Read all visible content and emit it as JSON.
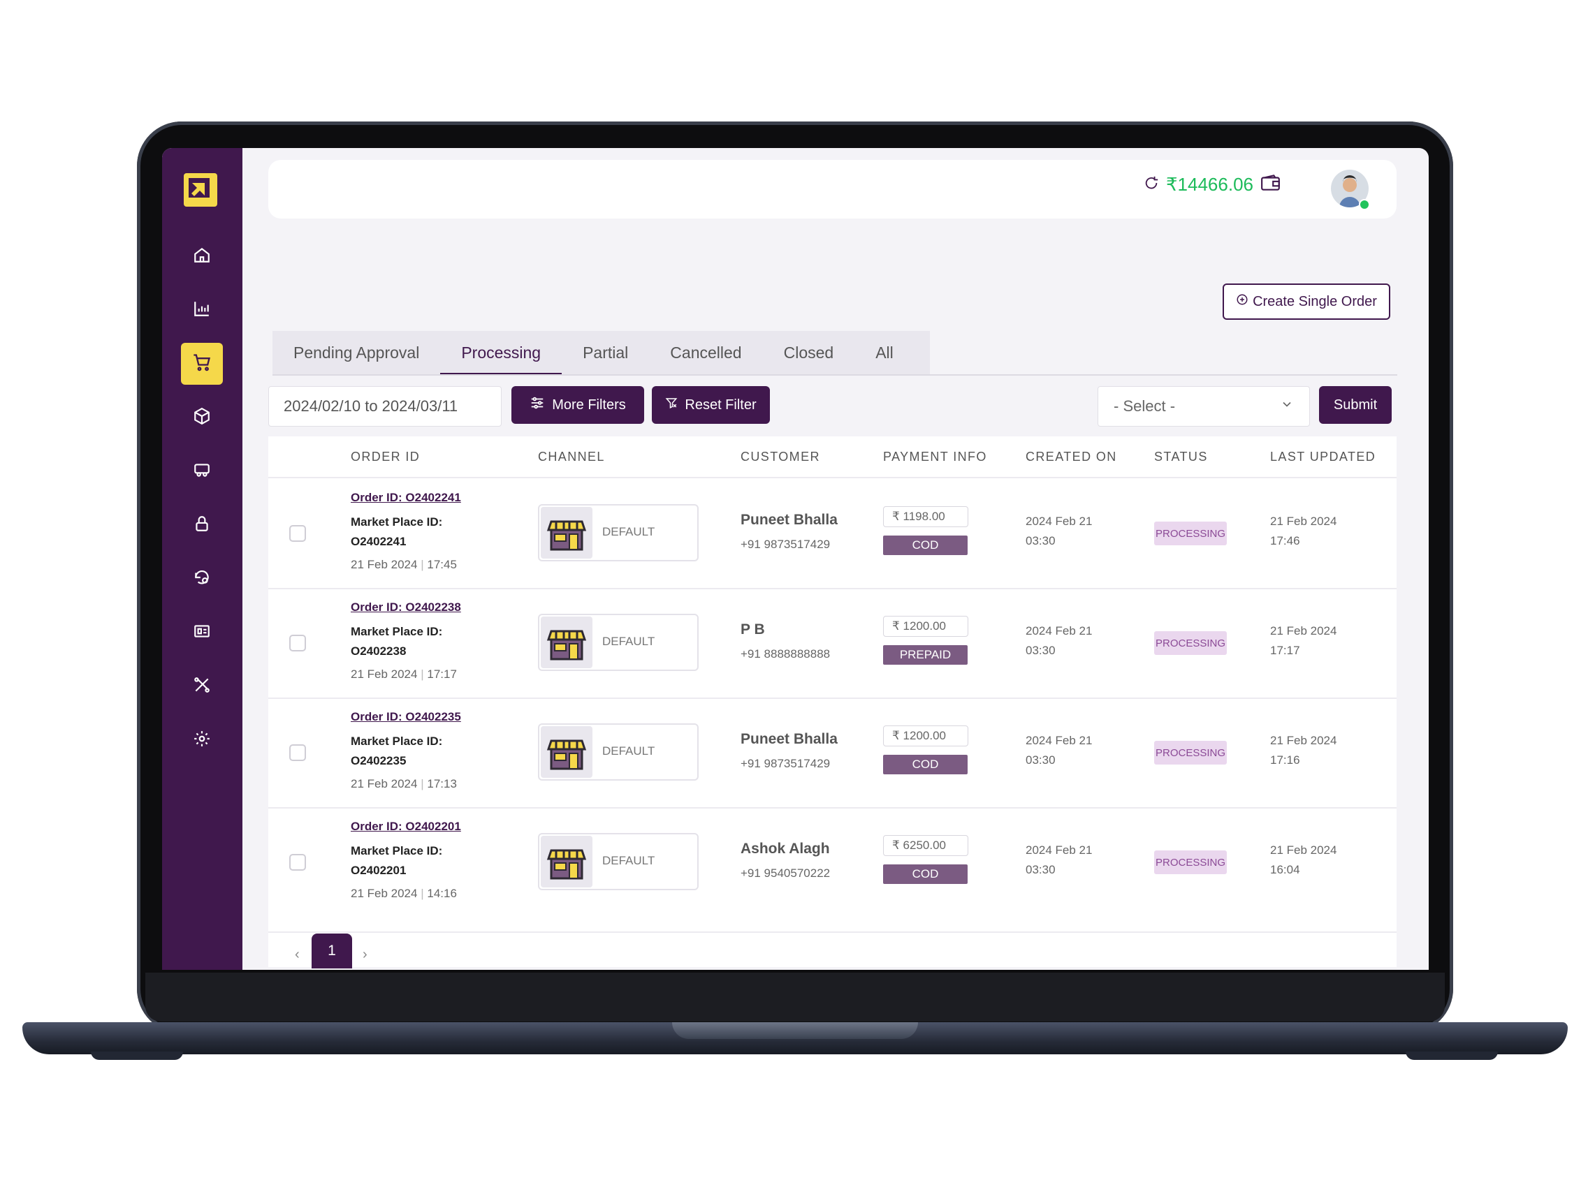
{
  "header": {
    "balance": "₹14466.06"
  },
  "actions": {
    "create_single_order": "Create Single Order"
  },
  "tabs": [
    {
      "label": "Pending Approval"
    },
    {
      "label": "Processing"
    },
    {
      "label": "Partial"
    },
    {
      "label": "Cancelled"
    },
    {
      "label": "Closed"
    },
    {
      "label": "All"
    }
  ],
  "active_tab": "Processing",
  "filters": {
    "date_range": "2024/02/10 to 2024/03/11",
    "more_filters": "More Filters",
    "reset_filter": "Reset Filter",
    "select_value": "- Select -",
    "submit": "Submit"
  },
  "table": {
    "columns": [
      "ORDER ID",
      "CHANNEL",
      "CUSTOMER",
      "PAYMENT INFO",
      "CREATED ON",
      "STATUS",
      "LAST UPDATED"
    ],
    "rows": [
      {
        "order_id": "Order ID: O2402241",
        "marketplace_label": "Market Place ID:",
        "marketplace_id": "O2402241",
        "order_date": "21 Feb 2024",
        "order_time": "17:45",
        "channel": "DEFAULT",
        "customer": "Puneet Bhalla",
        "phone": "+91 9873517429",
        "amount": "₹ 1198.00",
        "payment_mode": "COD",
        "created_date": "2024 Feb 21",
        "created_time": "03:30",
        "status": "PROCESSING",
        "updated_date": "21 Feb 2024",
        "updated_time": "17:46"
      },
      {
        "order_id": "Order ID: O2402238",
        "marketplace_label": "Market Place ID:",
        "marketplace_id": "O2402238",
        "order_date": "21 Feb 2024",
        "order_time": "17:17",
        "channel": "DEFAULT",
        "customer": "P B",
        "phone": "+91 8888888888",
        "amount": "₹ 1200.00",
        "payment_mode": "PREPAID",
        "created_date": "2024 Feb 21",
        "created_time": "03:30",
        "status": "PROCESSING",
        "updated_date": "21 Feb 2024",
        "updated_time": "17:17"
      },
      {
        "order_id": "Order ID: O2402235",
        "marketplace_label": "Market Place ID:",
        "marketplace_id": "O2402235",
        "order_date": "21 Feb 2024",
        "order_time": "17:13",
        "channel": "DEFAULT",
        "customer": "Puneet Bhalla",
        "phone": "+91 9873517429",
        "amount": "₹ 1200.00",
        "payment_mode": "COD",
        "created_date": "2024 Feb 21",
        "created_time": "03:30",
        "status": "PROCESSING",
        "updated_date": "21 Feb 2024",
        "updated_time": "17:16"
      },
      {
        "order_id": "Order ID: O2402201",
        "marketplace_label": "Market Place ID:",
        "marketplace_id": "O2402201",
        "order_date": "21 Feb 2024",
        "order_time": "14:16",
        "channel": "DEFAULT",
        "customer": "Ashok Alagh",
        "phone": "+91 9540570222",
        "amount": "₹ 6250.00",
        "payment_mode": "COD",
        "created_date": "2024 Feb 21",
        "created_time": "03:30",
        "status": "PROCESSING",
        "updated_date": "21 Feb 2024",
        "updated_time": "16:04"
      }
    ]
  },
  "pagination": {
    "prev": "‹",
    "current_page": "1",
    "next": "›"
  },
  "sidebar": {
    "items": [
      {
        "icon": "home-icon"
      },
      {
        "icon": "bar-chart-icon"
      },
      {
        "icon": "cart-icon",
        "active": true
      },
      {
        "icon": "box-icon"
      },
      {
        "icon": "delivery-truck-icon"
      },
      {
        "icon": "lock-icon"
      },
      {
        "icon": "returns-icon"
      },
      {
        "icon": "invoice-icon"
      },
      {
        "icon": "tools-icon"
      },
      {
        "icon": "settings-icon"
      }
    ]
  },
  "colors": {
    "brand_purple": "#40184d",
    "accent_yellow": "#f5d84a",
    "balance_green": "#1dbb5a",
    "status_bg": "#ead7ee",
    "payment_badge": "#7b5b82"
  }
}
